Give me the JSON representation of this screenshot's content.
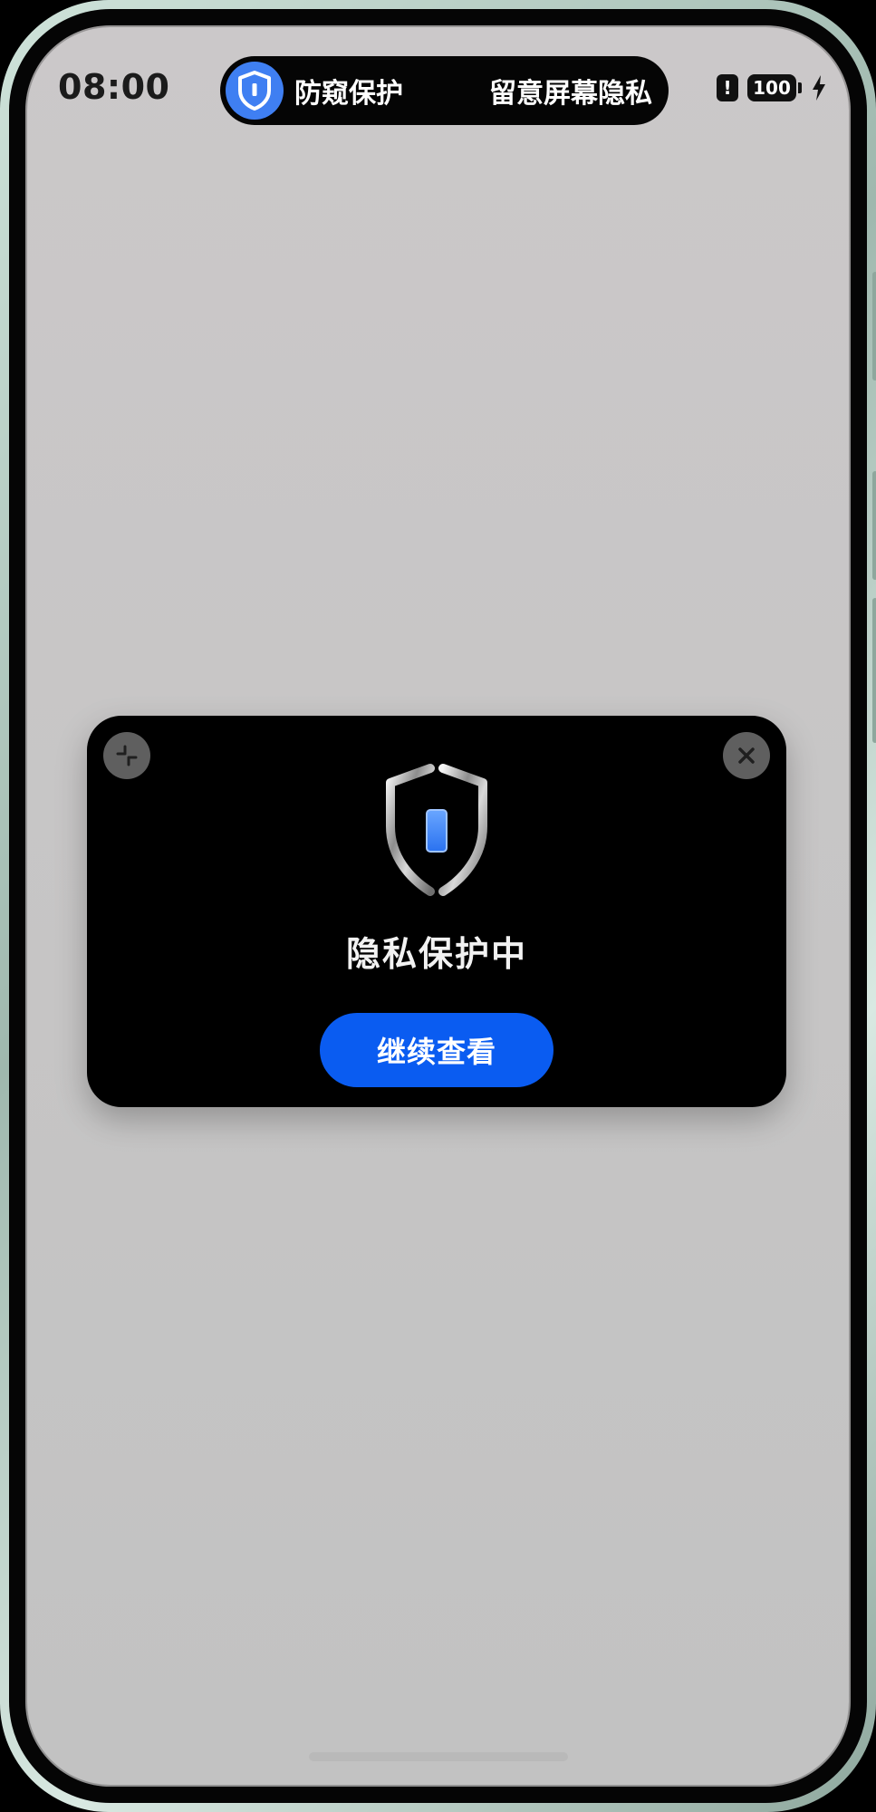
{
  "status_bar": {
    "time": "08:00",
    "battery_level": "100",
    "alert_glyph": "!",
    "icons": [
      "alert-icon",
      "battery-icon",
      "charging-bolt-icon"
    ]
  },
  "dynamic_island": {
    "title": "防窥保护",
    "subtitle": "留意屏幕隐私",
    "icon": "shield-icon",
    "icon_color": "#3f7ff2"
  },
  "privacy_card": {
    "status_text": "隐私保护中",
    "continue_button_label": "继续查看",
    "minimize_icon": "minimize-icon",
    "close_icon": "close-icon",
    "shield_icon": "shield-icon",
    "accent_color": "#0a5cf1"
  }
}
